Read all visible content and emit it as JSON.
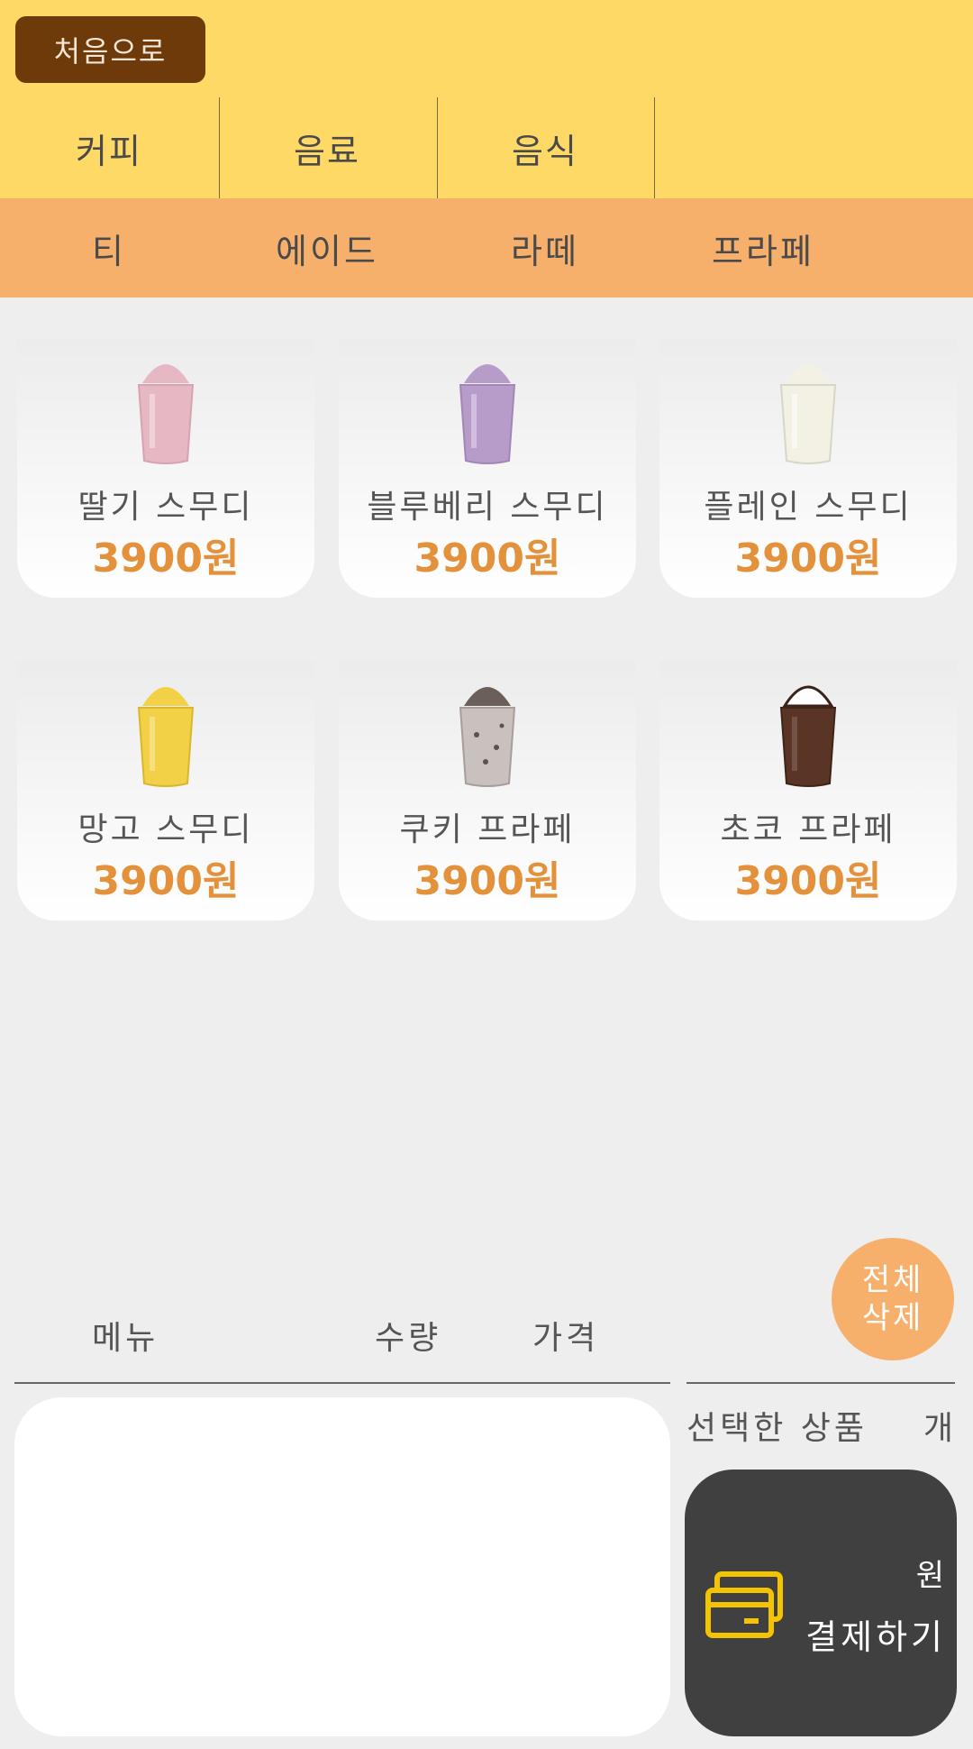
{
  "header": {
    "home_label": "처음으로"
  },
  "main_tabs": [
    {
      "label": "커피"
    },
    {
      "label": "음료"
    },
    {
      "label": "음식"
    }
  ],
  "sub_tabs": [
    {
      "label": "티"
    },
    {
      "label": "에이드"
    },
    {
      "label": "라떼"
    },
    {
      "label": "프라페"
    }
  ],
  "products": [
    {
      "name": "딸기 스무디",
      "price": "3900원",
      "image_icon": "strawberry-smoothie-image",
      "color": "#E6B8C4"
    },
    {
      "name": "블루베리 스무디",
      "price": "3900원",
      "image_icon": "blueberry-smoothie-image",
      "color": "#B79CC9"
    },
    {
      "name": "플레인 스무디",
      "price": "3900원",
      "image_icon": "plain-smoothie-image",
      "color": "#F2F1E4"
    },
    {
      "name": "망고 스무디",
      "price": "3900원",
      "image_icon": "mango-smoothie-image",
      "color": "#F3D147"
    },
    {
      "name": "쿠키 프라페",
      "price": "3900원",
      "image_icon": "cookie-frappe-image",
      "color": "#C9C1BE"
    },
    {
      "name": "초코 프라페",
      "price": "3900원",
      "image_icon": "choco-frappe-image",
      "color": "#5A3526"
    }
  ],
  "cart": {
    "clear_all_line1": "전체",
    "clear_all_line2": "삭제",
    "col_menu": "메뉴",
    "col_qty": "수량",
    "col_price": "가격",
    "selected_label": "선택한 상품",
    "selected_unit": "개",
    "total_unit": "원",
    "pay_label": "결제하기"
  },
  "colors": {
    "header_bg": "#FFD966",
    "subtab_bg": "#F7B06B",
    "home_button_bg": "#6E3A0A",
    "price_color": "#E3913A",
    "pay_button_bg": "#404040",
    "card_icon_color": "#F5C400"
  }
}
